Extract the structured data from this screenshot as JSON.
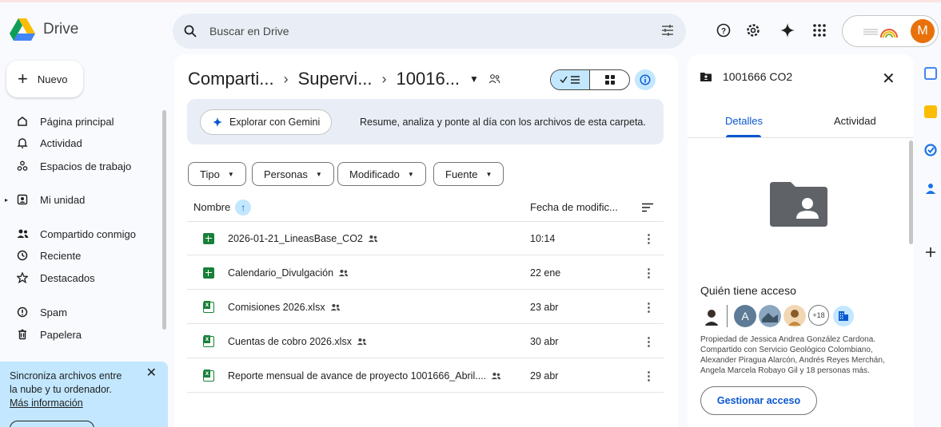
{
  "app": {
    "name": "Drive"
  },
  "search": {
    "placeholder": "Buscar en Drive"
  },
  "account": {
    "initial": "M"
  },
  "new_button": "Nuevo",
  "nav": [
    {
      "label": "Página principal",
      "icon": "home-icon"
    },
    {
      "label": "Actividad",
      "icon": "bell-icon"
    },
    {
      "label": "Espacios de trabajo",
      "icon": "workspaces-icon"
    },
    {
      "label": "Mi unidad",
      "icon": "my-drive-icon"
    },
    {
      "label": "Compartido conmigo",
      "icon": "shared-icon"
    },
    {
      "label": "Reciente",
      "icon": "clock-icon"
    },
    {
      "label": "Destacados",
      "icon": "star-icon"
    },
    {
      "label": "Spam",
      "icon": "spam-icon"
    },
    {
      "label": "Papelera",
      "icon": "trash-icon"
    }
  ],
  "sync_banner": {
    "text_line1": "Sincroniza archivos entre",
    "text_line2": "la nube y tu ordenador.",
    "link": "Más información"
  },
  "breadcrumbs": [
    "Comparti...",
    "Supervi...",
    "10016..."
  ],
  "gemini": {
    "button": "Explorar con Gemini",
    "text": "Resume, analiza y ponte al día con los archivos de esta carpeta."
  },
  "filters": [
    "Tipo",
    "Personas",
    "Modificado",
    "Fuente"
  ],
  "table": {
    "col_name": "Nombre",
    "col_date": "Fecha de modific...",
    "rows": [
      {
        "name": "2026-01-21_LineasBase_CO2",
        "type": "sheet",
        "date": "10:14"
      },
      {
        "name": "Calendario_Divulgación",
        "type": "sheet",
        "date": "22 ene"
      },
      {
        "name": "Comisiones 2026.xlsx",
        "type": "xlsx",
        "date": "23 abr"
      },
      {
        "name": "Cuentas de cobro 2026.xlsx",
        "type": "xlsx",
        "date": "30 abr"
      },
      {
        "name": "Reporte mensual de avance de proyecto 1001666_Abril....",
        "type": "xlsx",
        "date": "29 abr"
      }
    ]
  },
  "details": {
    "title": "1001666 CO2",
    "tab_details": "Detalles",
    "tab_activity": "Actividad",
    "access_heading": "Quién tiene acceso",
    "avatar_letter": "A",
    "more_count": "+18",
    "description": "Propiedad de Jessica Andrea González Cardona. Compartido con Servicio Geológico Colombiano, Alexander Piragua Alarcón, Andrés Reyes Merchán, Angela Marcela Robayo Gil y 18 personas más.",
    "manage_button": "Gestionar acceso"
  },
  "colors": {
    "accent": "#0b57d0",
    "selected_bg": "#c2e7ff",
    "sheets_green": "#188038",
    "account_orange": "#e8710a"
  }
}
